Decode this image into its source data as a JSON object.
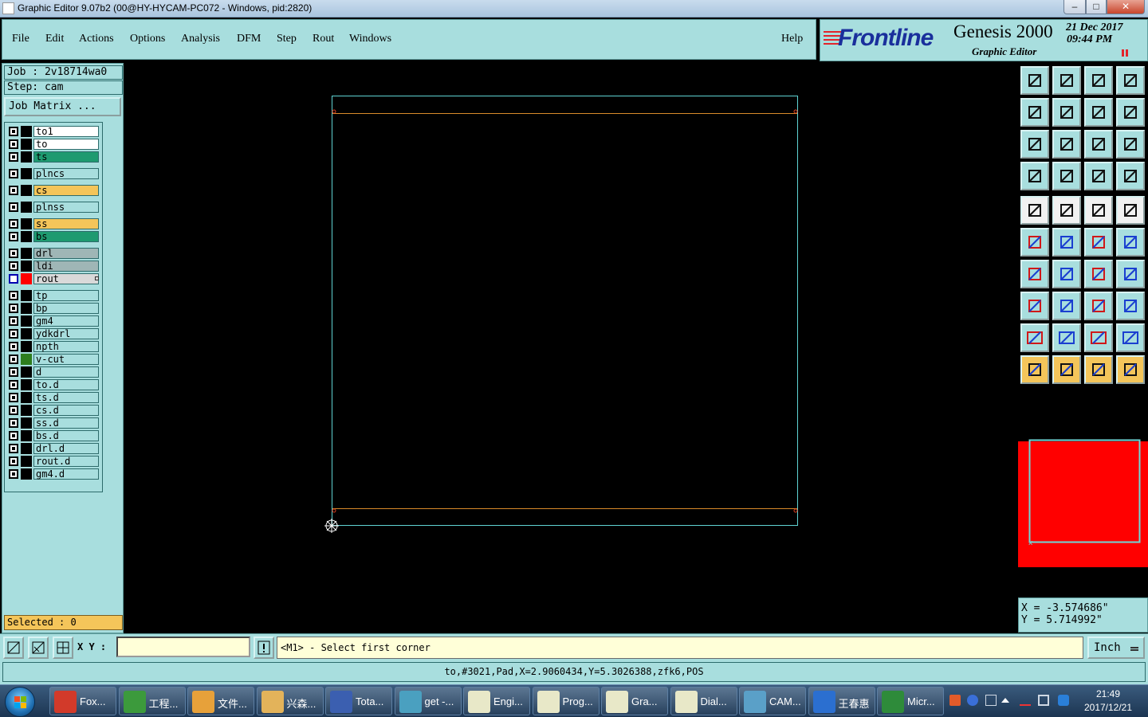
{
  "window": {
    "title": "Graphic Editor 9.07b2 (00@HY-HYCAM-PC072 - Windows, pid:2820)",
    "min": "–",
    "max": "□",
    "close": "✕"
  },
  "menu": {
    "file": "File",
    "edit": "Edit",
    "actions": "Actions",
    "options": "Options",
    "analysis": "Analysis",
    "dfm": "DFM",
    "step": "Step",
    "rout": "Rout",
    "windows": "Windows",
    "help": "Help"
  },
  "brand": {
    "logo": "Frontline",
    "product": "Genesis 2000",
    "subtitle": "Graphic Editor",
    "date": "21 Dec 2017",
    "time": "09:44 PM"
  },
  "job": {
    "job_line": "Job : 2v18714wa0",
    "step_line": "Step: cam",
    "matrix_button": "Job Matrix ..."
  },
  "layers": [
    {
      "name": "to1",
      "color": "#ffffff"
    },
    {
      "name": "to",
      "color": "#ffffff"
    },
    {
      "name": "ts",
      "color": "#1e9a70"
    },
    {
      "name": "plncs",
      "color": "#a8dede"
    },
    {
      "name": "cs",
      "color": "#f4c55a"
    },
    {
      "name": "plnss",
      "color": "#a8dede"
    },
    {
      "name": "ss",
      "color": "#f4c55a"
    },
    {
      "name": "bs",
      "color": "#1e9a70"
    },
    {
      "name": "drl",
      "color": "#9fb6b6"
    },
    {
      "name": "ldi",
      "color": "#9fb6b6"
    },
    {
      "name": "rout",
      "color": "#d9d9d9",
      "active": true
    },
    {
      "name": "tp",
      "color": "#a8dede"
    },
    {
      "name": "bp",
      "color": "#a8dede"
    },
    {
      "name": "gm4",
      "color": "#a8dede"
    },
    {
      "name": "ydkdrl",
      "color": "#a8dede"
    },
    {
      "name": "npth",
      "color": "#a8dede"
    },
    {
      "name": "v-cut",
      "color": "#a8dede",
      "swatch": "#2e7d1e"
    },
    {
      "name": "d",
      "color": "#a8dede"
    },
    {
      "name": "to.d",
      "color": "#a8dede"
    },
    {
      "name": "ts.d",
      "color": "#a8dede"
    },
    {
      "name": "cs.d",
      "color": "#a8dede"
    },
    {
      "name": "ss.d",
      "color": "#a8dede"
    },
    {
      "name": "bs.d",
      "color": "#a8dede"
    },
    {
      "name": "drl.d",
      "color": "#a8dede"
    },
    {
      "name": "rout.d",
      "color": "#a8dede"
    },
    {
      "name": "gm4.d",
      "color": "#a8dede"
    }
  ],
  "selected": "Selected : 0",
  "coords": {
    "x": "X = -3.574686\"",
    "y": "Y = 5.714992\""
  },
  "command": {
    "xy_label": "X Y :",
    "xy_value": "",
    "prompt": "<M1> - Select first corner",
    "units": "Inch"
  },
  "status": "to,#3021,Pad,X=2.9060434,Y=5.3026388,zfk6,POS",
  "taskbar": {
    "items": [
      {
        "label": "Fox...",
        "color": "#d23a2a"
      },
      {
        "label": "工程...",
        "color": "#3c9a3c"
      },
      {
        "label": "文件...",
        "color": "#e7a13a"
      },
      {
        "label": "兴森...",
        "color": "#e3b35a"
      },
      {
        "label": "Tota...",
        "color": "#3b5fb0"
      },
      {
        "label": "get -...",
        "color": "#4aa0c0"
      },
      {
        "label": "Engi...",
        "color": "#e8e8c8"
      },
      {
        "label": "Prog...",
        "color": "#e8e8c8"
      },
      {
        "label": "Gra...",
        "color": "#e8e8c8"
      },
      {
        "label": "Dial...",
        "color": "#e8e8c8"
      },
      {
        "label": "CAM...",
        "color": "#5aa0c8"
      },
      {
        "label": "王春惠",
        "color": "#2b6fd0"
      },
      {
        "label": "Micr...",
        "color": "#2e8b3a"
      }
    ],
    "time": "21:49",
    "date": "2017/12/21"
  }
}
